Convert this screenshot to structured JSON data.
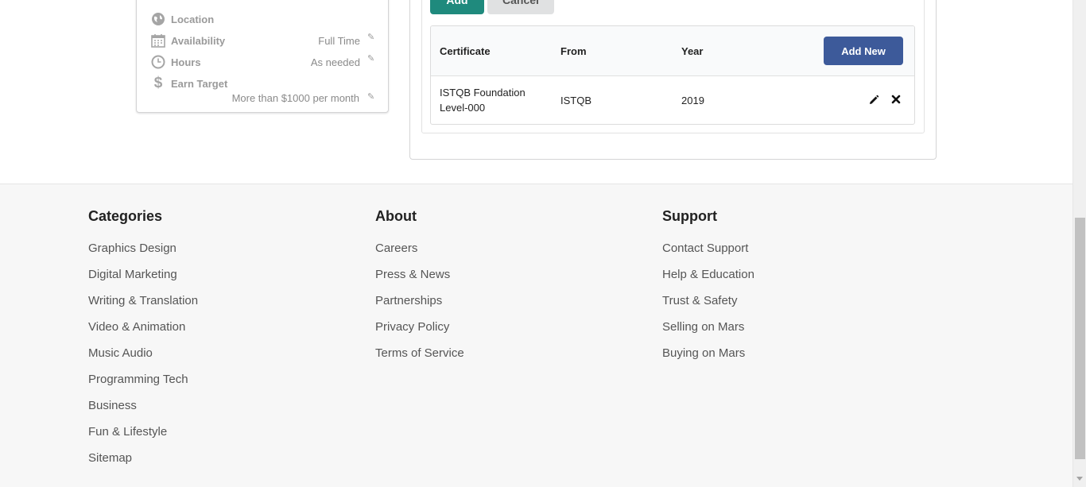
{
  "profile": {
    "location_label": "Location",
    "availability_label": "Availability",
    "availability_value": "Full Time",
    "hours_label": "Hours",
    "hours_value": "As needed",
    "earn_label": "Earn Target",
    "earn_value": "More than $1000 per month"
  },
  "cert_form": {
    "add_label": "Add",
    "cancel_label": "Cancel"
  },
  "cert_table": {
    "headers": {
      "certificate": "Certificate",
      "from": "From",
      "year": "Year"
    },
    "add_new_label": "Add New",
    "rows": [
      {
        "certificate_line1": "ISTQB Foundation",
        "certificate_line2": "Level-000",
        "from": "ISTQB",
        "year": "2019"
      }
    ]
  },
  "footer": {
    "categories": {
      "title": "Categories",
      "items": [
        "Graphics Design",
        "Digital Marketing",
        "Writing & Translation",
        "Video & Animation",
        "Music Audio",
        "Programming Tech",
        "Business",
        "Fun & Lifestyle",
        "Sitemap"
      ]
    },
    "about": {
      "title": "About",
      "items": [
        "Careers",
        "Press & News",
        "Partnerships",
        "Privacy Policy",
        "Terms of Service"
      ]
    },
    "support": {
      "title": "Support",
      "items": [
        "Contact Support",
        "Help & Education",
        "Trust & Safety",
        "Selling on Mars",
        "Buying on Mars"
      ]
    }
  },
  "colors": {
    "add_button": "#1f8a7d",
    "add_new_button": "#3d5a9a",
    "cancel_button": "#e0e1e2",
    "footer_bg": "#f7f7f7"
  }
}
